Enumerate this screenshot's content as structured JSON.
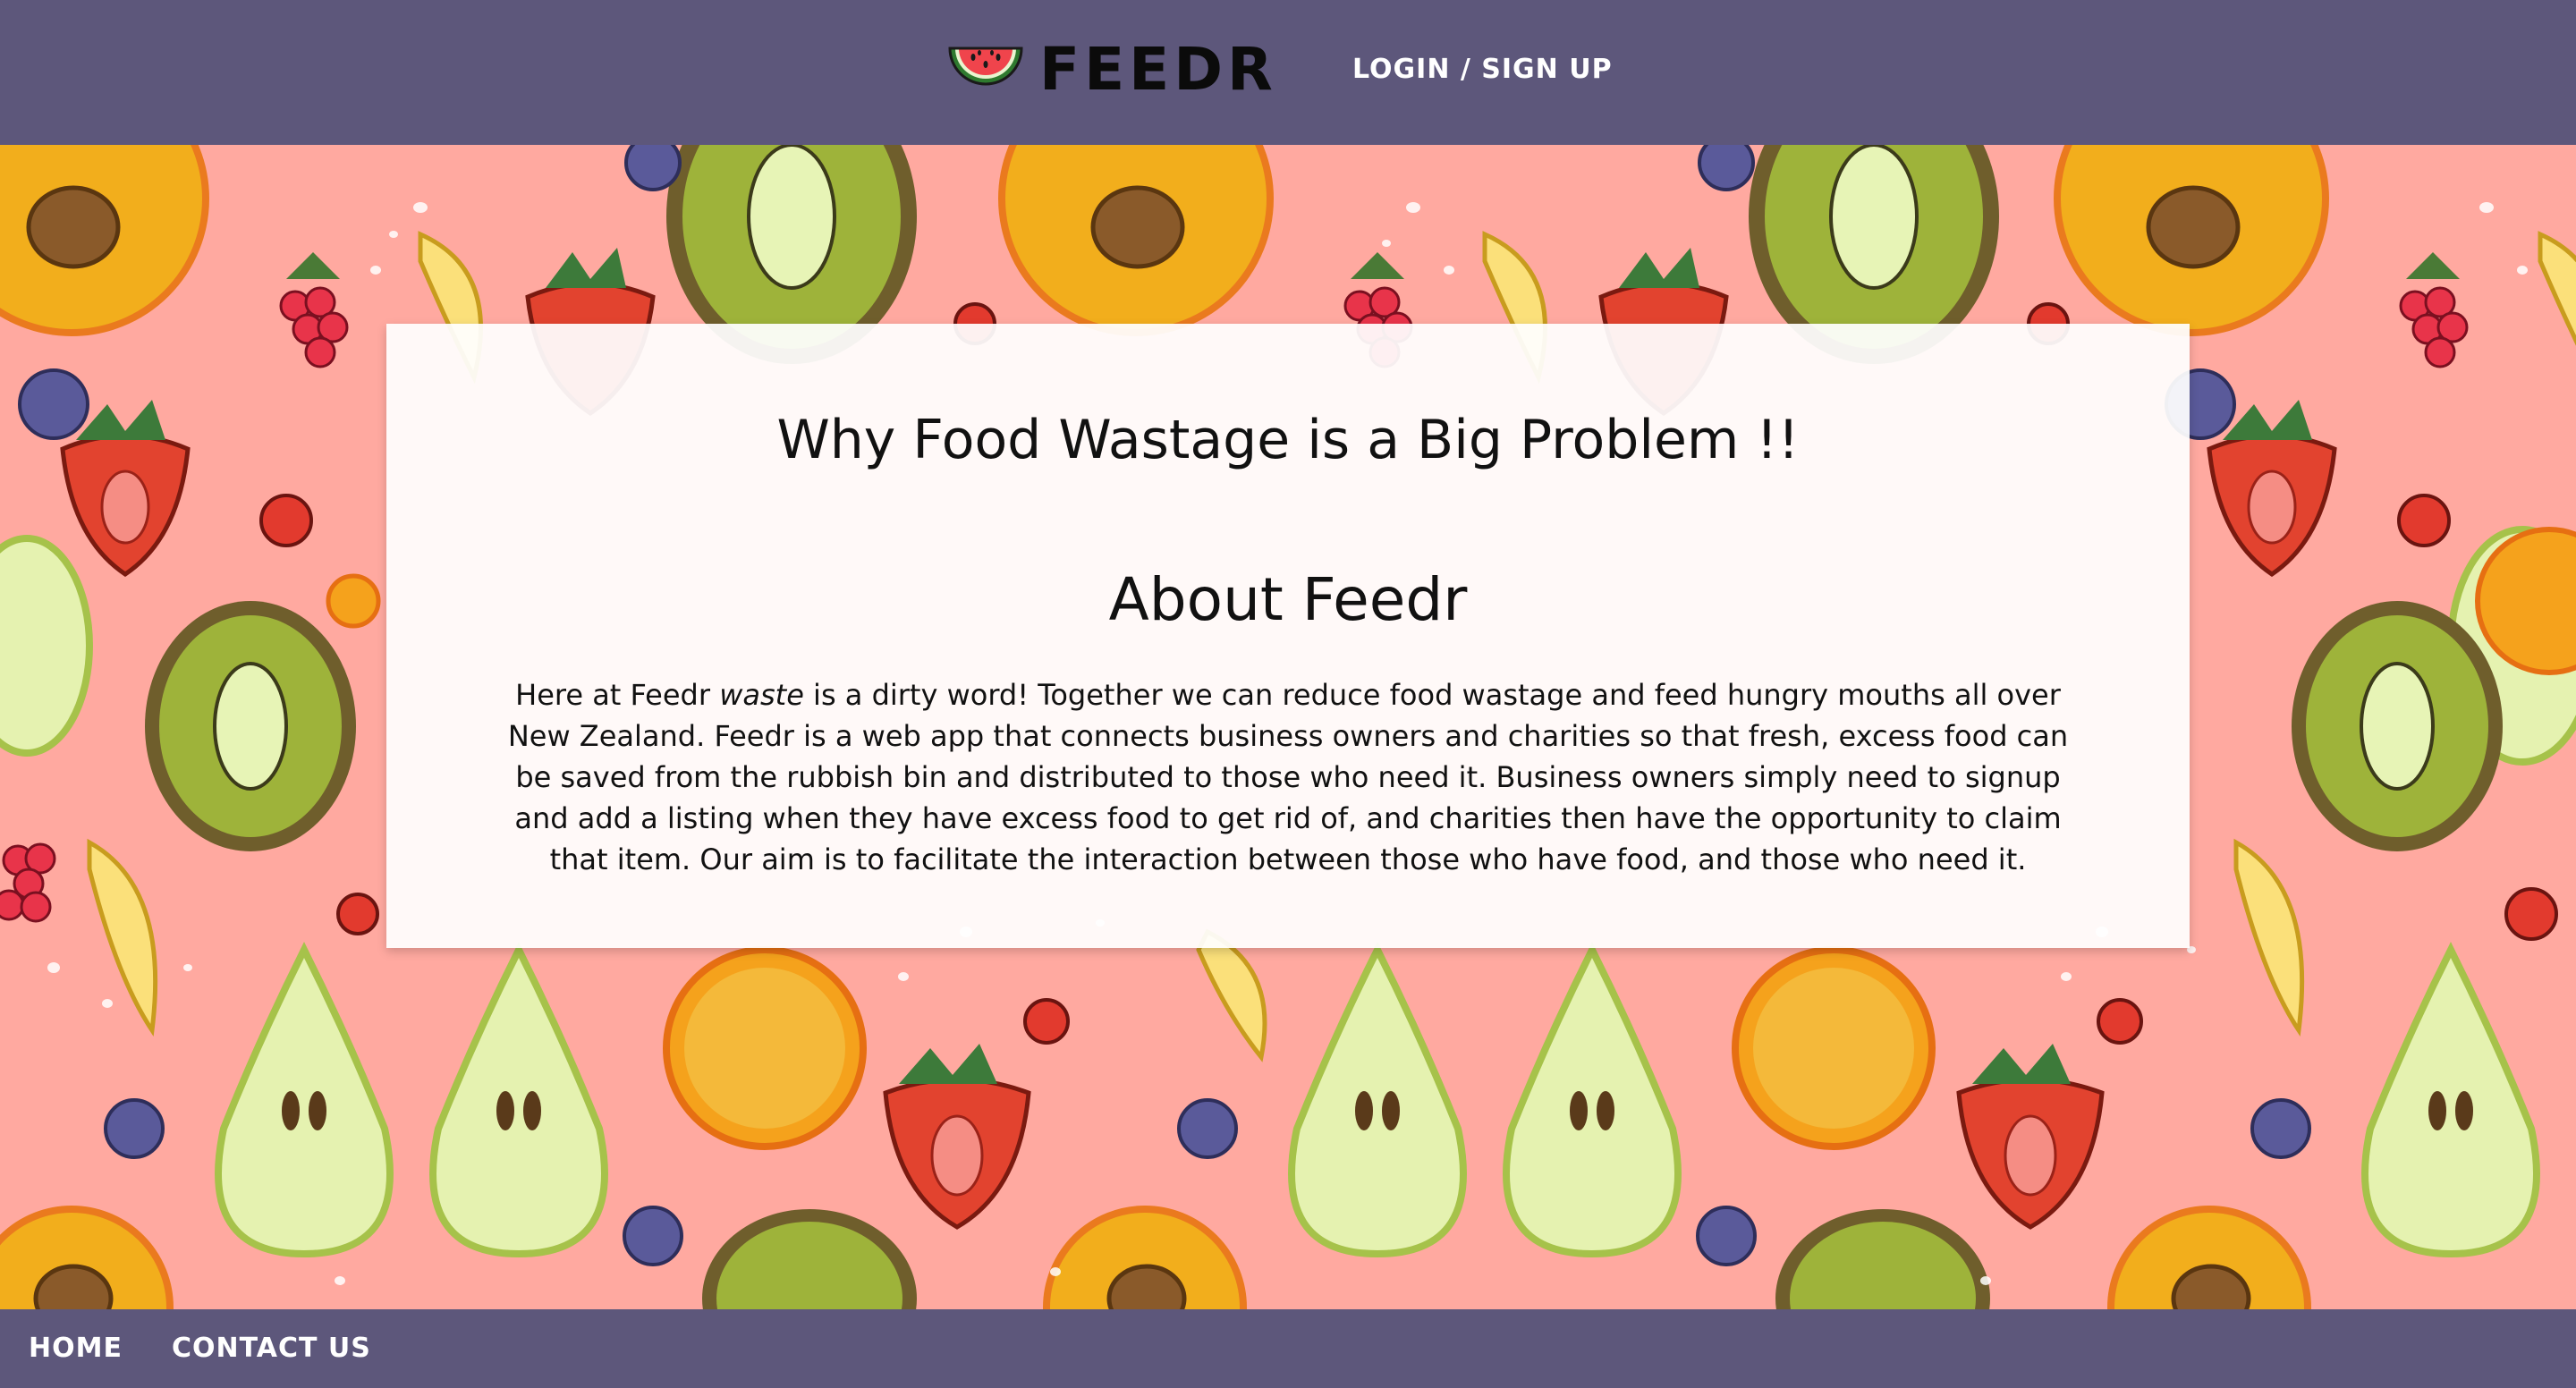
{
  "header": {
    "brand": "FEEDR",
    "login_label": "LOGIN / SIGN UP",
    "logo_icon": "watermelon-icon",
    "background_color": "#5d577b"
  },
  "main": {
    "title": "Why Food Wastage is a Big Problem !!",
    "subtitle": "About Feedr",
    "paragraph_intro": "Here at Feedr ",
    "paragraph_em": "waste",
    "paragraph_rest": " is a dirty word! Together we can reduce food wastage and feed hungry mouths all over New Zealand. Feedr is a web app that connects business owners and charities so that fresh, excess food can be saved from the rubbish bin and distributed to those who need it. Business owners simply need to signup and add a listing when they have excess food to get rid of, and charities then have the opportunity to claim that item. Our aim is to facilitate the interaction between those who have food, and those who need it."
  },
  "background": {
    "pattern": "fruit-pattern",
    "base_color": "#ffa9a0"
  },
  "footer": {
    "links": [
      {
        "label": "HOME"
      },
      {
        "label": "CONTACT US"
      }
    ]
  }
}
